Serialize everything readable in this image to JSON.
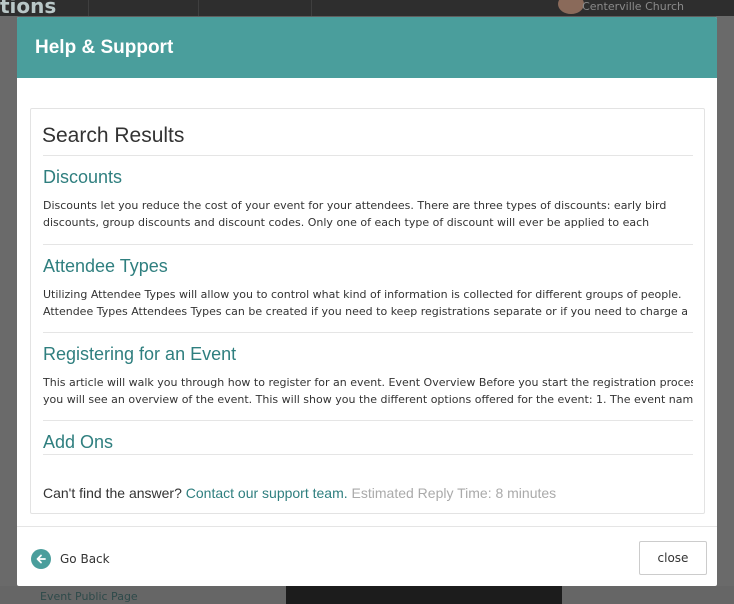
{
  "background": {
    "brand_partial": "tions",
    "church_name": "Centerville Church",
    "bottom_link": "Event Public Page"
  },
  "modal": {
    "title": "Help & Support",
    "results_heading": "Search Results",
    "results": [
      {
        "title": "Discounts",
        "snippet_line1": "Discounts let you reduce the cost of your event for your attendees. There are three types of discounts: early bird",
        "snippet_line2": "discounts, group discounts and discount codes. Only one of each type of discount will ever be applied to each"
      },
      {
        "title": "Attendee Types",
        "snippet_line1": "Utilizing Attendee Types will allow you to control what kind of information is collected for different groups of people.",
        "snippet_line2": "Attendee Types Attendees Types can be created if you need to keep registrations separate or if you need to charge a"
      },
      {
        "title": "Registering for an Event",
        "snippet_line1": "This article will walk you through how to register for an event. Event Overview Before you start the registration process",
        "snippet_line2": "you will see an overview of the event. This will show you the different options offered for the event: 1. The event name"
      },
      {
        "title": "Add Ons"
      }
    ],
    "cant_find_text": "Can't find the answer?",
    "contact_link": "Contact our support team.",
    "eta_text": "Estimated Reply Time: 8 minutes",
    "go_back_label": "Go Back",
    "close_label": "close"
  },
  "colors": {
    "header": "#4a9e9c",
    "link": "#2f7f7f",
    "overlay": "#5f5f5f"
  },
  "icons": {
    "go_back": "arrow-left-circle-icon"
  }
}
